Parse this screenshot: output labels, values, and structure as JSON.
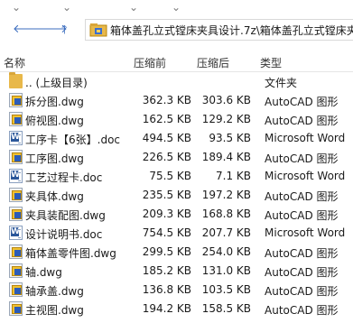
{
  "address": {
    "path": "箱体盖孔立式镗床夹具设计.7z\\箱体盖孔立式镗床夹具"
  },
  "columns": {
    "name": "名称",
    "original_size": "压缩前",
    "compressed_size": "压缩后",
    "type": "类型"
  },
  "files": [
    {
      "name": ".. (上级目录)",
      "original": "",
      "compressed": "",
      "type": "文件夹",
      "icon": "folder-icon"
    },
    {
      "name": "拆分图.dwg",
      "original": "362.3 KB",
      "compressed": "303.6 KB",
      "type": "AutoCAD 图形",
      "icon": "dwg-file-icon"
    },
    {
      "name": "俯视图.dwg",
      "original": "162.5 KB",
      "compressed": "129.2 KB",
      "type": "AutoCAD 图形",
      "icon": "dwg-file-icon"
    },
    {
      "name": "工序卡【6张】.doc",
      "original": "494.5 KB",
      "compressed": "93.5 KB",
      "type": "Microsoft Word",
      "icon": "word-doc-icon"
    },
    {
      "name": "工序图.dwg",
      "original": "226.5 KB",
      "compressed": "189.4 KB",
      "type": "AutoCAD 图形",
      "icon": "dwg-file-icon"
    },
    {
      "name": "工艺过程卡.doc",
      "original": "75.5 KB",
      "compressed": "7.1 KB",
      "type": "Microsoft Word",
      "icon": "word-doc-icon"
    },
    {
      "name": "夹具体.dwg",
      "original": "235.5 KB",
      "compressed": "197.2 KB",
      "type": "AutoCAD 图形",
      "icon": "dwg-file-icon"
    },
    {
      "name": "夹具装配图.dwg",
      "original": "209.3 KB",
      "compressed": "168.8 KB",
      "type": "AutoCAD 图形",
      "icon": "dwg-file-icon"
    },
    {
      "name": "设计说明书.doc",
      "original": "754.5 KB",
      "compressed": "207.7 KB",
      "type": "Microsoft Word",
      "icon": "word-doc-icon"
    },
    {
      "name": "箱体盖零件图.dwg",
      "original": "299.5 KB",
      "compressed": "254.0 KB",
      "type": "AutoCAD 图形",
      "icon": "dwg-file-icon"
    },
    {
      "name": "轴.dwg",
      "original": "185.2 KB",
      "compressed": "131.0 KB",
      "type": "AutoCAD 图形",
      "icon": "dwg-file-icon"
    },
    {
      "name": "轴承盖.dwg",
      "original": "136.8 KB",
      "compressed": "103.5 KB",
      "type": "AutoCAD 图形",
      "icon": "dwg-file-icon"
    },
    {
      "name": "主视图.dwg",
      "original": "194.2 KB",
      "compressed": "158.5 KB",
      "type": "AutoCAD 图形",
      "icon": "dwg-file-icon"
    }
  ]
}
